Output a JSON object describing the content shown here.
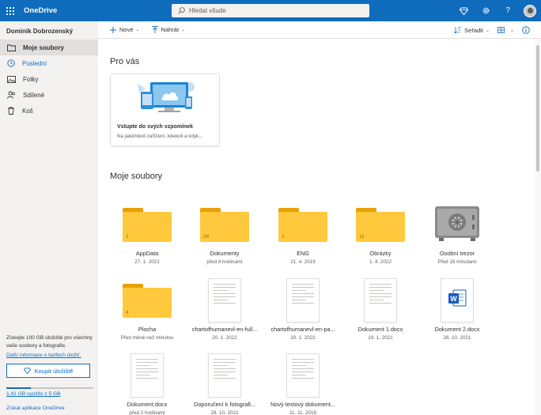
{
  "topbar": {
    "app_name": "OneDrive",
    "search_placeholder": "Hledat všude",
    "icons": [
      "diamond-icon",
      "gear-icon",
      "help-icon",
      "avatar"
    ],
    "help_label": "?"
  },
  "sidebar": {
    "user_name": "Dominik Dobrozenský",
    "items": [
      {
        "label": "Moje soubory",
        "icon": "folder-icon",
        "selected": true
      },
      {
        "label": "Poslední",
        "icon": "clock-icon"
      },
      {
        "label": "Fotky",
        "icon": "photo-icon"
      },
      {
        "label": "Sdílené",
        "icon": "people-icon"
      },
      {
        "label": "Koš",
        "icon": "trash-icon"
      }
    ],
    "promo_text": "Získejte 100 GB úložiště pro všechny vaše soubory a fotografie.",
    "promo_link": "Další informace o tarifech úložiť.",
    "buy_button": "Koupit úložiště",
    "storage_text": "1,41 GB využito z 5 GB",
    "storage_fraction": 0.28,
    "get_apps": "Získat aplikace OneDrive"
  },
  "commandbar": {
    "new_label": "Nové",
    "upload_label": "Nahrát",
    "sort_label": "Seřadit"
  },
  "main": {
    "for_you_title": "Pro vás",
    "card": {
      "title": "Vstupte do svých vzpomínek",
      "subtitle": "Na jakémkoli zařízení, kdekoli a kdyk..."
    },
    "my_files_title": "Moje soubory",
    "files": [
      {
        "name": "AppData",
        "meta": "27. 1. 2021",
        "type": "folder",
        "count": "1"
      },
      {
        "name": "Dokumenty",
        "meta": "před 4 hodinami",
        "type": "folder",
        "count": "34"
      },
      {
        "name": "ENG",
        "meta": "21. 4. 2019",
        "type": "folder",
        "count": "1"
      },
      {
        "name": "Obrázky",
        "meta": "1. 4. 2022",
        "type": "folder",
        "count": "11"
      },
      {
        "name": "Osobní trezor",
        "meta": "Před 16 minutami",
        "type": "vault"
      },
      {
        "name": "Plocha",
        "meta": "Před méně než minutou",
        "type": "folder",
        "count": "4"
      },
      {
        "name": "chartofhumanevl-en-full...",
        "meta": "20. 1. 2022",
        "type": "doc"
      },
      {
        "name": "chartofhumanevl-en-pa...",
        "meta": "20. 1. 2022",
        "type": "doc"
      },
      {
        "name": "Dokument 1.docx",
        "meta": "19. 1. 2021",
        "type": "doc"
      },
      {
        "name": "Dokument 2.docx",
        "meta": "28. 10. 2021",
        "type": "word"
      },
      {
        "name": "Dokument.docx",
        "meta": "před 2 hodinami",
        "type": "doc"
      },
      {
        "name": "Doporučení k fotografi...",
        "meta": "28. 10. 2021",
        "type": "doc"
      },
      {
        "name": "Nový textový dokument...",
        "meta": "11. 11. 2018",
        "type": "doc"
      }
    ]
  }
}
